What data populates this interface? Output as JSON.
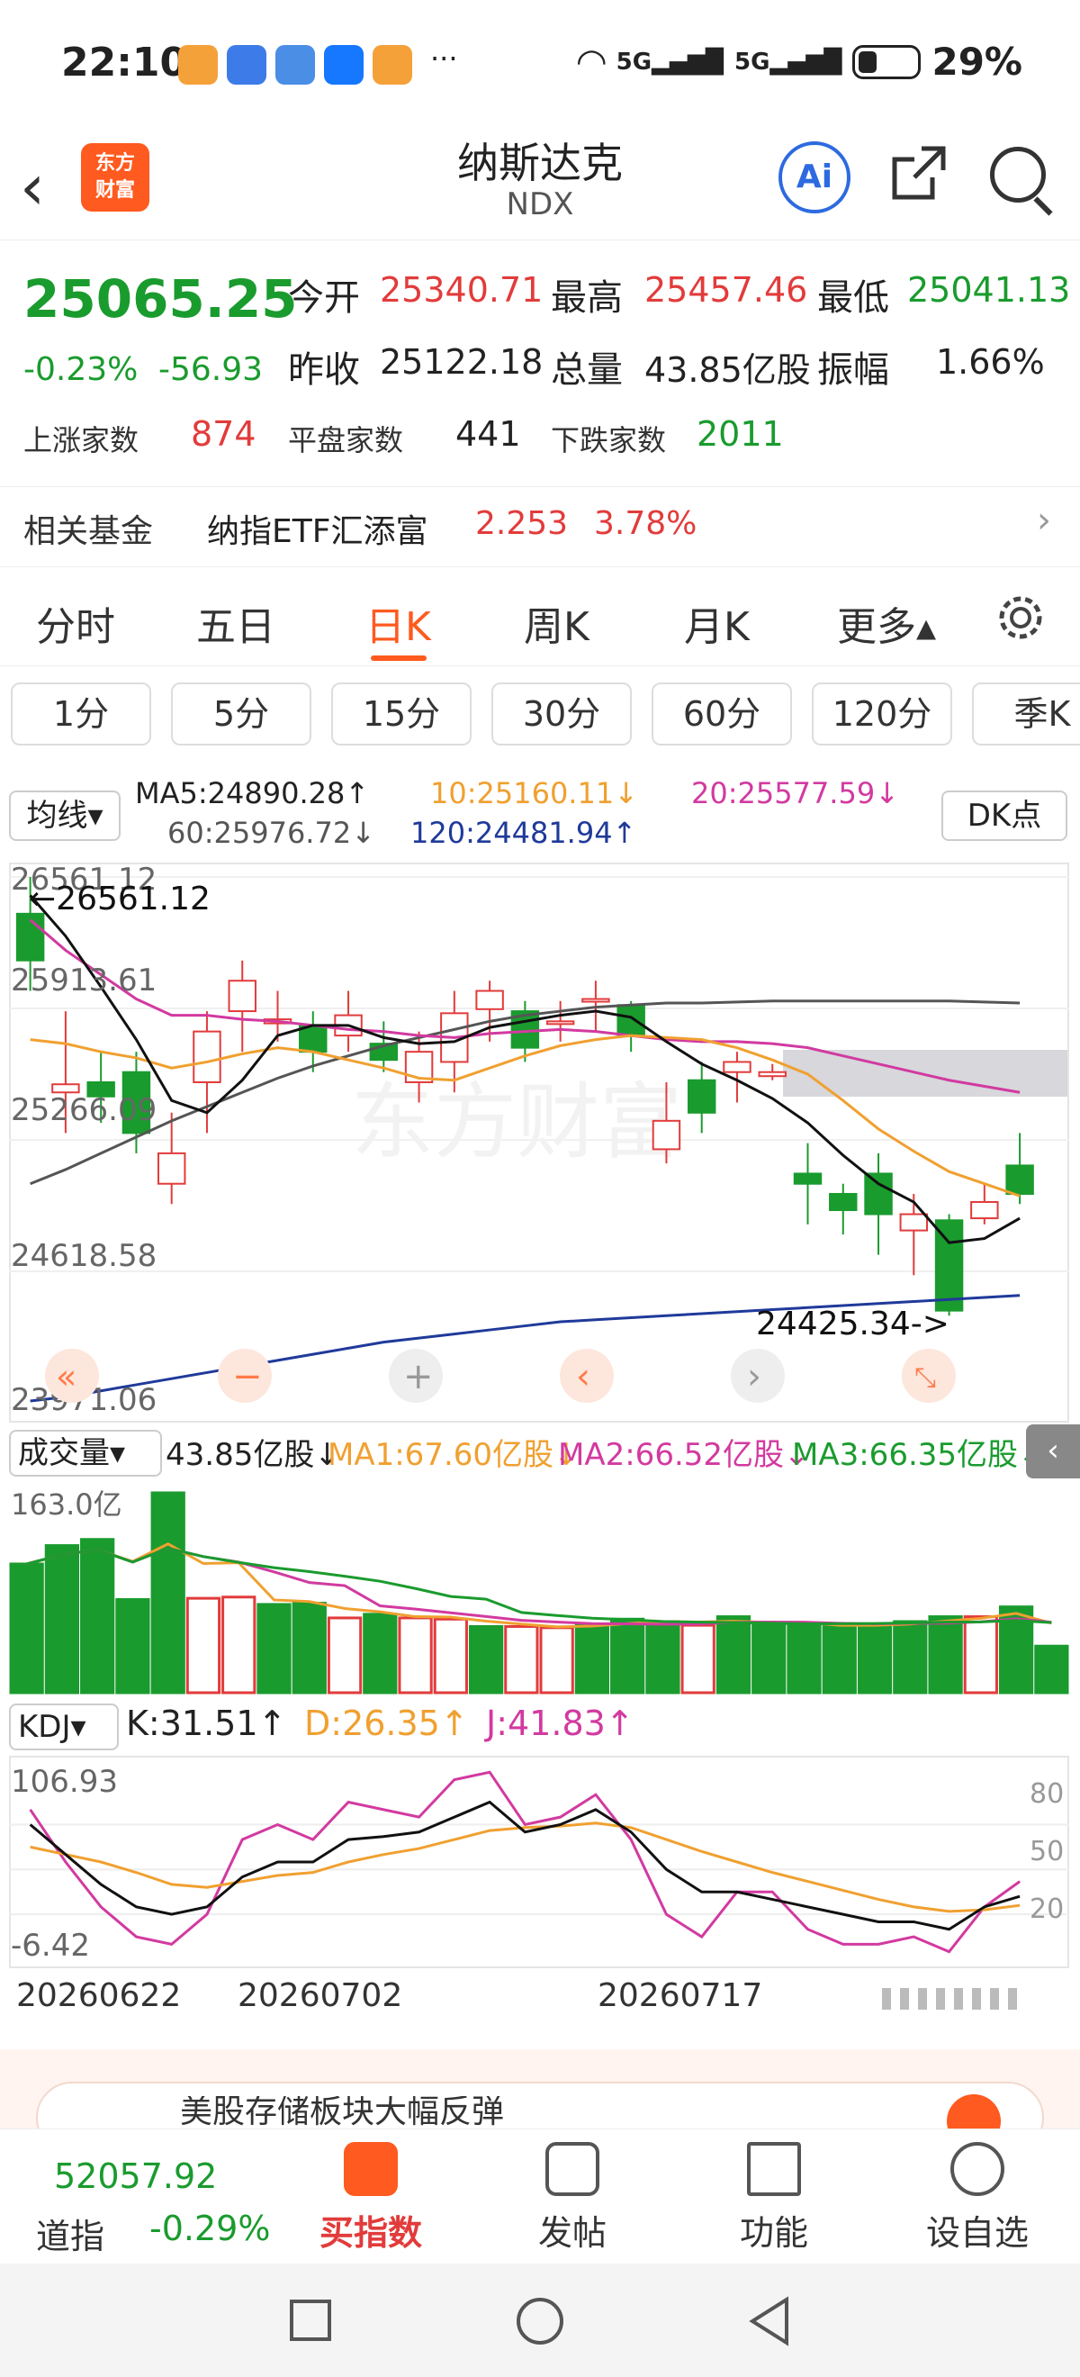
{
  "status_bar": {
    "time": "22:10",
    "more": "···",
    "net1": "5G",
    "net2": "5G",
    "battery": "29%"
  },
  "header": {
    "back": "‹",
    "logo_line1": "东方",
    "logo_line2": "财富",
    "title": "纳斯达克",
    "subtitle": "NDX",
    "ai_label": "Ai"
  },
  "quote": {
    "price": "25065.25",
    "change_pct": "-0.23%",
    "change": "-56.93",
    "open_label": "今开",
    "open": "25340.71",
    "high_label": "最高",
    "high": "25457.46",
    "low_label": "最低",
    "low": "25041.13",
    "prev_label": "昨收",
    "prev": "25122.18",
    "vol_label": "总量",
    "vol": "43.85亿股",
    "amp_label": "振幅",
    "amp": "1.66%",
    "up_label": "上涨家数",
    "up": "874",
    "flat_label": "平盘家数",
    "flat": "441",
    "down_label": "下跌家数",
    "down": "2011"
  },
  "fund": {
    "label": "相关基金",
    "name": "纳指ETF汇添富",
    "price": "2.253",
    "pct": "3.78%",
    "arrow": "›"
  },
  "tabs": [
    "分时",
    "五日",
    "日K",
    "周K",
    "月K",
    "更多▴"
  ],
  "subtabs": [
    "1分",
    "5分",
    "15分",
    "30分",
    "60分",
    "120分",
    "季K"
  ],
  "ma_row": {
    "selector": "均线▾",
    "ma5": "MA5:24890.28↑",
    "ma10": "10:25160.11↓",
    "ma20": "20:25577.59↓",
    "ma60": "60:25976.72↓",
    "ma120": "120:24481.94↑",
    "dk": "DK点"
  },
  "colors": {
    "up": "#e23b3b",
    "down": "#1a9b2e",
    "accent": "#ff5a1f",
    "ma5": "#111111",
    "ma10": "#f0a030",
    "ma20": "#d23aa0",
    "ma60": "#555555",
    "ma120": "#1f3a9a"
  },
  "kline_labels": {
    "y1": "26561.12",
    "y2": "25913.61",
    "y3": "25266.09",
    "y4": "24618.58",
    "y5": "23971.06",
    "hi_note": "←26561.12",
    "lo_note": "24425.34->",
    "watermark": "东方财富"
  },
  "chart_data": {
    "type": "candlestick",
    "ylim": [
      23971.06,
      26561.12
    ],
    "candles": [
      [
        26380,
        26150,
        26561,
        26000,
        0
      ],
      [
        25540,
        25500,
        25900,
        25300,
        1
      ],
      [
        25480,
        25550,
        25700,
        25350,
        0
      ],
      [
        25300,
        25600,
        25700,
        25200,
        0
      ],
      [
        25200,
        25050,
        25400,
        24950,
        1
      ],
      [
        25800,
        25550,
        25900,
        25300,
        1
      ],
      [
        25900,
        26050,
        26150,
        25700,
        1
      ],
      [
        25860,
        25840,
        26000,
        25750,
        1
      ],
      [
        25700,
        25830,
        25900,
        25600,
        0
      ],
      [
        25780,
        25880,
        26000,
        25700,
        1
      ],
      [
        25740,
        25660,
        25850,
        25600,
        0
      ],
      [
        25550,
        25700,
        25800,
        25450,
        1
      ],
      [
        25650,
        25890,
        26000,
        25500,
        1
      ],
      [
        25910,
        26000,
        26050,
        25750,
        1
      ],
      [
        25720,
        25900,
        25950,
        25650,
        0
      ],
      [
        25850,
        25850,
        25950,
        25750,
        1
      ],
      [
        25960,
        25950,
        26050,
        25800,
        1
      ],
      [
        25930,
        25780,
        25950,
        25700,
        0
      ],
      [
        25220,
        25360,
        25550,
        25150,
        1
      ],
      [
        25560,
        25400,
        25650,
        25300,
        0
      ],
      [
        25650,
        25600,
        25700,
        25450,
        1
      ],
      [
        25600,
        25580,
        25640,
        25560,
        1
      ],
      [
        25100,
        25050,
        25250,
        24850,
        0
      ],
      [
        25000,
        24920,
        25050,
        24800,
        0
      ],
      [
        25100,
        24900,
        25200,
        24700,
        0
      ],
      [
        24820,
        24900,
        25000,
        24600,
        1
      ],
      [
        24870,
        24425,
        24900,
        24400,
        0
      ],
      [
        24880,
        24960,
        25050,
        24850,
        1
      ],
      [
        25140,
        25000,
        25300,
        24950,
        0
      ]
    ],
    "ma5": [
      26470,
      26270,
      26020,
      25760,
      25460,
      25400,
      25560,
      25780,
      25830,
      25830,
      25770,
      25740,
      25750,
      25820,
      25850,
      25880,
      25900,
      25870,
      25750,
      25640,
      25560,
      25470,
      25350,
      25190,
      25050,
      24960,
      24760,
      24780,
      24880
    ],
    "ma10": [
      25760,
      25740,
      25700,
      25670,
      25620,
      25650,
      25690,
      25720,
      25700,
      25660,
      25620,
      25570,
      25560,
      25620,
      25680,
      25730,
      25760,
      25780,
      25770,
      25760,
      25720,
      25660,
      25590,
      25460,
      25320,
      25210,
      25110,
      25050,
      24990
    ],
    "ma20": [
      26350,
      26200,
      26080,
      25960,
      25880,
      25880,
      25860,
      25850,
      25830,
      25810,
      25800,
      25780,
      25770,
      25790,
      25800,
      25810,
      25800,
      25780,
      25760,
      25750,
      25750,
      25740,
      25720,
      25680,
      25640,
      25600,
      25560,
      25530,
      25500
    ],
    "ma60": [
      25050,
      25120,
      25200,
      25280,
      25360,
      25430,
      25500,
      25570,
      25630,
      25680,
      25730,
      25770,
      25810,
      25850,
      25880,
      25900,
      25920,
      25930,
      25940,
      25940,
      25945,
      25950,
      25950,
      25950,
      25950,
      25950,
      25950,
      25945,
      25940
    ],
    "ma120": [
      23980,
      24000,
      24030,
      24060,
      24090,
      24120,
      24150,
      24180,
      24210,
      24240,
      24270,
      24290,
      24310,
      24330,
      24350,
      24370,
      24380,
      24390,
      24400,
      24410,
      24420,
      24430,
      24440,
      24450,
      24460,
      24470,
      24480,
      24490,
      24500
    ]
  },
  "volume": {
    "selector": "成交量▾",
    "vol": "43.85亿股↓",
    "ma1": "MA1:67.60亿股↓",
    "ma2": "MA2:66.52亿股↓",
    "ma3": "MA3:66.35亿股↓",
    "ytop": "163.0亿",
    "values": [
      105,
      120,
      125,
      76,
      163,
      77,
      78,
      72,
      73,
      61,
      64,
      61,
      60,
      54,
      54,
      53,
      56,
      60,
      58,
      55,
      62,
      55,
      55,
      55,
      55,
      58,
      62,
      62,
      70,
      38
    ],
    "up": [
      0,
      0,
      0,
      0,
      0,
      1,
      1,
      0,
      0,
      1,
      0,
      1,
      1,
      0,
      1,
      1,
      0,
      0,
      0,
      1,
      0,
      0,
      0,
      0,
      0,
      0,
      0,
      1,
      0
    ]
  },
  "kdj": {
    "selector": "KDJ▾",
    "k": "K:31.51↑",
    "d": "D:26.35↑",
    "j": "J:41.83↑",
    "ytop": "106.93",
    "ybot": "-6.42",
    "r80": "80",
    "r50": "50",
    "r20": "20",
    "kv": [
      80,
      60,
      40,
      25,
      20,
      25,
      45,
      55,
      55,
      70,
      72,
      75,
      85,
      95,
      75,
      80,
      90,
      75,
      50,
      35,
      35,
      30,
      25,
      20,
      15,
      15,
      10,
      25,
      32
    ],
    "dv": [
      65,
      60,
      55,
      48,
      40,
      38,
      42,
      46,
      48,
      55,
      60,
      64,
      70,
      76,
      78,
      79,
      81,
      78,
      70,
      62,
      55,
      48,
      42,
      36,
      30,
      25,
      22,
      23,
      26
    ],
    "jv": [
      90,
      55,
      25,
      5,
      0,
      20,
      70,
      80,
      70,
      95,
      90,
      85,
      110,
      115,
      80,
      85,
      100,
      70,
      20,
      5,
      35,
      35,
      10,
      0,
      0,
      5,
      -5,
      25,
      42
    ]
  },
  "dates": [
    "20260622",
    "20260702",
    "20260717"
  ],
  "banner": {
    "text": "美股存储板块大幅反弹"
  },
  "bottom_nav": {
    "index_value": "52057.92",
    "index_name": "道指",
    "index_pct": "-0.29%",
    "buy": "买指数",
    "post": "发帖",
    "func": "功能",
    "watch": "设自选"
  }
}
